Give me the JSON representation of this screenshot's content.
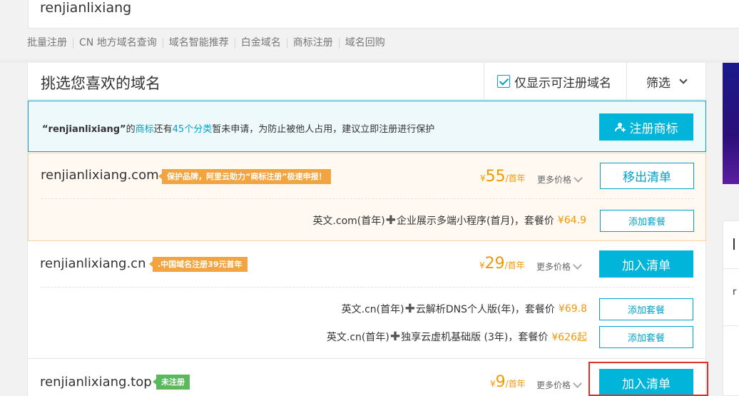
{
  "search": {
    "value": "renjianlixiang"
  },
  "quicklinks": [
    "批量注册",
    "CN 地方域名查询",
    "域名智能推荐",
    "白金域名",
    "商标注册",
    "域名回购"
  ],
  "panel": {
    "title": "挑选您喜欢的域名",
    "only_available_label": "仅显示可注册域名",
    "filter_label": "筛选"
  },
  "notice": {
    "name": "“renjianlixiang”",
    "t1": "的",
    "link1": "商标",
    "t2": "还有",
    "link2": "45个分类",
    "t3": "暂未申请，为防止被他人占用，建议立即注册进行保护",
    "button": "注册商标"
  },
  "items": [
    {
      "domain": "renjianlixiang.com",
      "tag": "保护品牌，阿里云助力“商标注册”极速申报！",
      "currency": "¥",
      "price": "55",
      "unit": "/首年",
      "more": "更多价格",
      "action": "移出清单",
      "packages": [
        {
          "a": "英文.com(首年)",
          "b": "企业展示多端小程序(首月)，套餐价",
          "price": "¥64.9",
          "button": "添加套餐"
        }
      ]
    },
    {
      "domain": "renjianlixiang.cn",
      "tag": ".中国域名注册39元首年",
      "currency": "¥",
      "price": "29",
      "unit": "/首年",
      "more": "更多价格",
      "action": "加入清单",
      "packages": [
        {
          "a": "英文.cn(首年)",
          "b": "云解析DNS个人版(年)，套餐价",
          "price": "¥69.8",
          "button": "添加套餐"
        },
        {
          "a": "英文.cn(首年)",
          "b": "独享云虚机基础版 (3年)，套餐价",
          "price": "¥626起",
          "button": "添加套餐"
        }
      ]
    },
    {
      "domain": "renjianlixiang.top",
      "tag": "未注册",
      "currency": "¥",
      "price": "9",
      "unit": "/首年",
      "more": "更多价格",
      "action": "加入清单"
    }
  ],
  "side": {
    "letter_a": "r"
  },
  "colors": {
    "accent": "#00b5d9",
    "price": "#f39800",
    "tag_orange": "#f1a440",
    "tag_green": "#5bb85d",
    "highlight": "#e0302a"
  }
}
